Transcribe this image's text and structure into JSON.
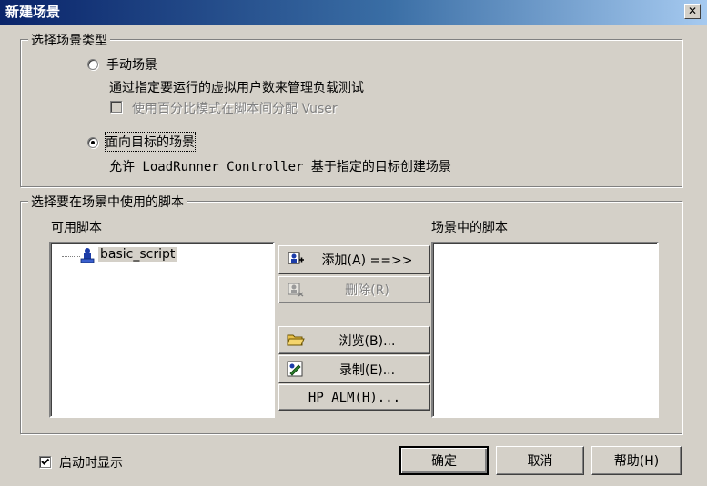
{
  "window": {
    "title": "新建场景",
    "close_symbol": "✕"
  },
  "scenario_type": {
    "legend": "选择场景类型",
    "manual": {
      "label": "手动场景",
      "description": "通过指定要运行的虚拟用户数来管理负载测试",
      "checked": false,
      "percent_mode": {
        "label": "使用百分比模式在脚本间分配 Vuser",
        "checked": false,
        "enabled": false
      }
    },
    "goal": {
      "label": "面向目标的场景",
      "description": "允许 LoadRunner Controller 基于指定的目标创建场景",
      "checked": true
    }
  },
  "scripts": {
    "legend": "选择要在场景中使用的脚本",
    "available_label": "可用脚本",
    "scenario_label": "场景中的脚本",
    "available_items": [
      {
        "name": "basic_script",
        "icon": "vuser-script-icon"
      }
    ],
    "scenario_items": []
  },
  "buttons": {
    "add": {
      "label": "添加(A) ==>>",
      "icon": "add-script-icon",
      "enabled": true
    },
    "remove": {
      "label": "删除(R)",
      "icon": "remove-script-icon",
      "enabled": false
    },
    "browse": {
      "label": "浏览(B)...",
      "icon": "folder-open-icon",
      "enabled": true
    },
    "record": {
      "label": "录制(E)...",
      "icon": "record-icon",
      "enabled": true
    },
    "hp_alm": {
      "label": "HP ALM(H)...",
      "enabled": true
    },
    "ok": {
      "label": "确定"
    },
    "cancel": {
      "label": "取消"
    },
    "help": {
      "label": "帮助(H)"
    }
  },
  "footer": {
    "show_at_startup": {
      "label": "启动时显示",
      "checked": true
    }
  },
  "colors": {
    "title_start": "#0a246a",
    "title_end": "#a6caf0",
    "face": "#d4d0c8",
    "icon_blue": "#1c3ca8"
  }
}
